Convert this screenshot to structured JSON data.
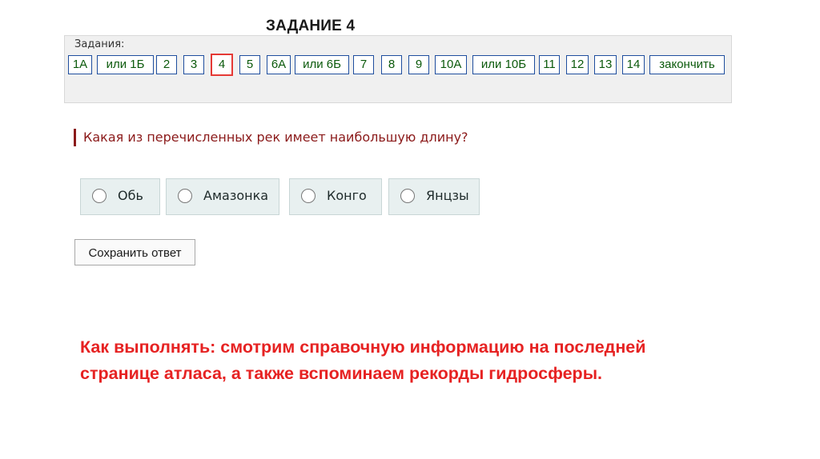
{
  "slide": {
    "title": "ЗАДАНИЕ 4"
  },
  "task_panel": {
    "label": "Задания:",
    "items": [
      "1А",
      "или 1Б",
      "2",
      "3",
      "4",
      "5",
      "6А",
      "или 6Б",
      "7",
      "8",
      "9",
      "10А",
      "или 10Б",
      "11",
      "12",
      "13",
      "14",
      "закончить"
    ],
    "active": "4",
    "colors": {
      "text": "#0b5a0b",
      "border": "#1f4e9e",
      "active_border": "#e53935"
    }
  },
  "question": {
    "text": "Какая из перечисленных рек имеет наибольшую длину?",
    "color": "#8b1a1a"
  },
  "answers": [
    {
      "label": "Обь",
      "selected": false
    },
    {
      "label": "Амазонка",
      "selected": false
    },
    {
      "label": "Конго",
      "selected": false
    },
    {
      "label": "Янцзы",
      "selected": false
    }
  ],
  "save_button": {
    "label": "Сохранить ответ"
  },
  "instruction": {
    "line1": "Как выполнять: смотрим справочную информацию на последней",
    "line2": "странице атласа, а также вспоминаем рекорды гидросферы.",
    "color": "#e62222"
  }
}
